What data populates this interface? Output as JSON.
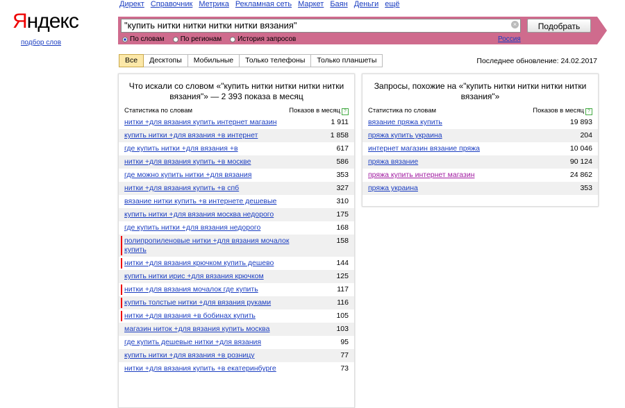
{
  "logo": {
    "first_letter": "Я",
    "rest": "ндекс"
  },
  "podbor_link": "подбор слов",
  "topnav": [
    "Директ",
    "Справочник",
    "Метрика",
    "Рекламная сеть",
    "Маркет",
    "Баян",
    "Деньги",
    "ещё"
  ],
  "search": {
    "value": "\"купить нитки  нитки нитки нитки вязания\"",
    "clear_icon": "×",
    "button": "Подобрать",
    "region": "Россия",
    "radios": [
      {
        "label": "По словам",
        "checked": true
      },
      {
        "label": "По регионам",
        "checked": false
      },
      {
        "label": "История запросов",
        "checked": false
      }
    ]
  },
  "tabs": [
    "Все",
    "Десктопы",
    "Мобильные",
    "Только телефоны",
    "Только планшеты"
  ],
  "active_tab": "Все",
  "last_update": "Последнее обновление: 24.02.2017",
  "left_panel": {
    "title": "Что искали со словом «\"купить нитки нитки нитки нитки вязания\"» — 2 393 показа в месяц",
    "col_left": "Статистика по словам",
    "col_right": "Показов в месяц",
    "rows": [
      {
        "kw": "нитки +для вязания купить интернет магазин",
        "n": "1 911",
        "marked": false
      },
      {
        "kw": "купить нитки +для вязания +в интернет",
        "n": "1 858",
        "marked": false
      },
      {
        "kw": "где купить нитки +для вязания +в",
        "n": "617",
        "marked": false
      },
      {
        "kw": "нитки +для вязания купить +в москве",
        "n": "586",
        "marked": false
      },
      {
        "kw": "где можно купить нитки +для вязания",
        "n": "353",
        "marked": false
      },
      {
        "kw": "нитки +для вязания купить +в спб",
        "n": "327",
        "marked": false
      },
      {
        "kw": "вязание нитки купить +в интернете дешевые",
        "n": "310",
        "marked": false
      },
      {
        "kw": "купить нитки +для вязания москва недорого",
        "n": "175",
        "marked": false
      },
      {
        "kw": "где купить нитки +для вязания недорого",
        "n": "168",
        "marked": false
      },
      {
        "kw": "полипропиленовые нитки +для вязания мочалок купить",
        "n": "158",
        "marked": true
      },
      {
        "kw": "нитки +для вязания крючком купить дешево",
        "n": "144",
        "marked": true
      },
      {
        "kw": "купить нитки ирис +для вязания крючком",
        "n": "125",
        "marked": false
      },
      {
        "kw": "нитки +для вязания мочалок где купить",
        "n": "117",
        "marked": true
      },
      {
        "kw": "купить толстые нитки +для вязания руками",
        "n": "116",
        "marked": true
      },
      {
        "kw": "нитки +для вязания +в бобинах купить",
        "n": "105",
        "marked": true
      },
      {
        "kw": "магазин ниток +для вязания купить москва",
        "n": "103",
        "marked": false
      },
      {
        "kw": "где купить дешевые нитки +для вязания",
        "n": "95",
        "marked": false
      },
      {
        "kw": "купить нитки +для вязания +в розницу",
        "n": "77",
        "marked": false
      },
      {
        "kw": "нитки +для вязания купить +в екатеринбурге",
        "n": "73",
        "marked": false
      }
    ]
  },
  "right_panel": {
    "title": "Запросы, похожие на «\"купить нитки нитки нитки нитки вязания\"»",
    "col_left": "Статистика по словам",
    "col_right": "Показов в месяц",
    "rows": [
      {
        "kw": "вязание пряжа купить",
        "n": "19 893",
        "visited": false
      },
      {
        "kw": "пряжа купить украина",
        "n": "204",
        "visited": false
      },
      {
        "kw": "интернет магазин вязание пряжа",
        "n": "10 046",
        "visited": false
      },
      {
        "kw": "пряжа вязание",
        "n": "90 124",
        "visited": false
      },
      {
        "kw": "пряжа купить интернет магазин",
        "n": "24 862",
        "visited": true
      },
      {
        "kw": "пряжа украина",
        "n": "353",
        "visited": false
      }
    ]
  },
  "help_icon": "?"
}
